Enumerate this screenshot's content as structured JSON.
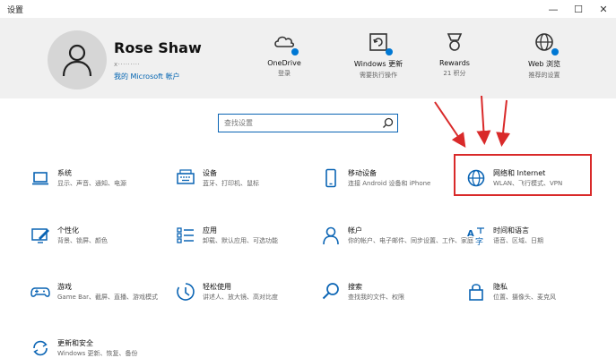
{
  "window": {
    "title": "设置",
    "minimize_glyph": "—",
    "maximize_glyph": "☐",
    "close_glyph": "✕"
  },
  "profile": {
    "name": "Rose Shaw",
    "email_masked": "x·········",
    "account_link": "我的 Microsoft 帐户"
  },
  "header_items": [
    {
      "icon": "onedrive-icon",
      "label": "OneDrive",
      "sub": "登录"
    },
    {
      "icon": "windows-update-icon",
      "label": "Windows 更新",
      "sub": "需要执行操作"
    },
    {
      "icon": "rewards-icon",
      "label": "Rewards",
      "sub": "21 积分"
    },
    {
      "icon": "web-browsing-icon",
      "label": "Web 浏览",
      "sub": "推荐的设置"
    }
  ],
  "search": {
    "placeholder": "查找设置"
  },
  "categories": [
    {
      "icon": "laptop-icon",
      "title": "系统",
      "desc": "显示、声音、通知、电源"
    },
    {
      "icon": "keyboard-icon",
      "title": "设备",
      "desc": "蓝牙、打印机、鼠标"
    },
    {
      "icon": "phone-icon",
      "title": "移动设备",
      "desc": "连接 Android 设备和 iPhone"
    },
    {
      "icon": "globe-icon",
      "title": "网络和 Internet",
      "desc": "WLAN、飞行模式、VPN"
    },
    {
      "icon": "personalization-icon",
      "title": "个性化",
      "desc": "背景、锁屏、颜色"
    },
    {
      "icon": "apps-icon",
      "title": "应用",
      "desc": "卸载、默认应用、可选功能"
    },
    {
      "icon": "person-icon",
      "title": "帐户",
      "desc": "你的帐户、电子邮件、同步设置、工作、家庭"
    },
    {
      "icon": "time-language-icon",
      "title": "时间和语言",
      "desc": "语音、区域、日期"
    },
    {
      "icon": "gamepad-icon",
      "title": "游戏",
      "desc": "Game Bar、截屏、直播、游戏模式"
    },
    {
      "icon": "accessibility-icon",
      "title": "轻松使用",
      "desc": "讲述人、放大镜、高对比度"
    },
    {
      "icon": "search-icon",
      "title": "搜索",
      "desc": "查找我的文件、权限"
    },
    {
      "icon": "lock-icon",
      "title": "隐私",
      "desc": "位置、摄像头、麦克风"
    },
    {
      "icon": "update-security-icon",
      "title": "更新和安全",
      "desc": "Windows 更新、恢复、备份"
    }
  ],
  "colors": {
    "accent": "#0078d4",
    "icon_blue": "#0a64b4",
    "annotation_red": "#d92a2a",
    "header_bg": "#f0f0f0"
  }
}
